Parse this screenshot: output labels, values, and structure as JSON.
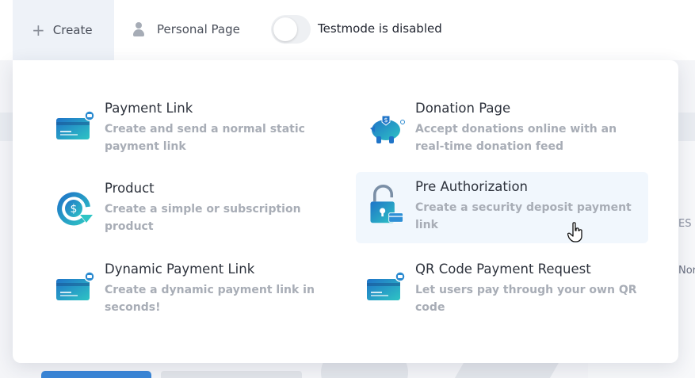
{
  "topbar": {
    "create_label": "Create",
    "personal_page_label": "Personal Page",
    "testmode_label": "Testmode is disabled",
    "testmode_enabled": false
  },
  "background": {
    "partial_text_1": "ES",
    "partial_text_2": "Nor"
  },
  "menu": {
    "items": [
      {
        "title": "Payment Link",
        "description": "Create and send a normal static payment link",
        "icon": "payment-card-icon"
      },
      {
        "title": "Donation Page",
        "description": "Accept donations online with an real-time donation feed",
        "icon": "piggy-bank-icon"
      },
      {
        "title": "Product",
        "description": "Create a simple or subscription product",
        "icon": "dollar-refresh-icon"
      },
      {
        "title": "Pre Authorization",
        "description": "Create a security deposit payment link",
        "icon": "padlock-card-icon",
        "hovered": true
      },
      {
        "title": "Dynamic Payment Link",
        "description": "Create a dynamic payment link in seconds!",
        "icon": "payment-card-icon"
      },
      {
        "title": "QR Code Payment Request",
        "description": "Let users pay through your own QR code",
        "icon": "payment-card-icon"
      }
    ]
  },
  "colors": {
    "icon_gradient_start": "#1f74c8",
    "icon_gradient_end": "#2ec4c4",
    "hover_background": "#f1f7fd",
    "title_text": "#2d323c",
    "description_text": "#a8adb6"
  }
}
